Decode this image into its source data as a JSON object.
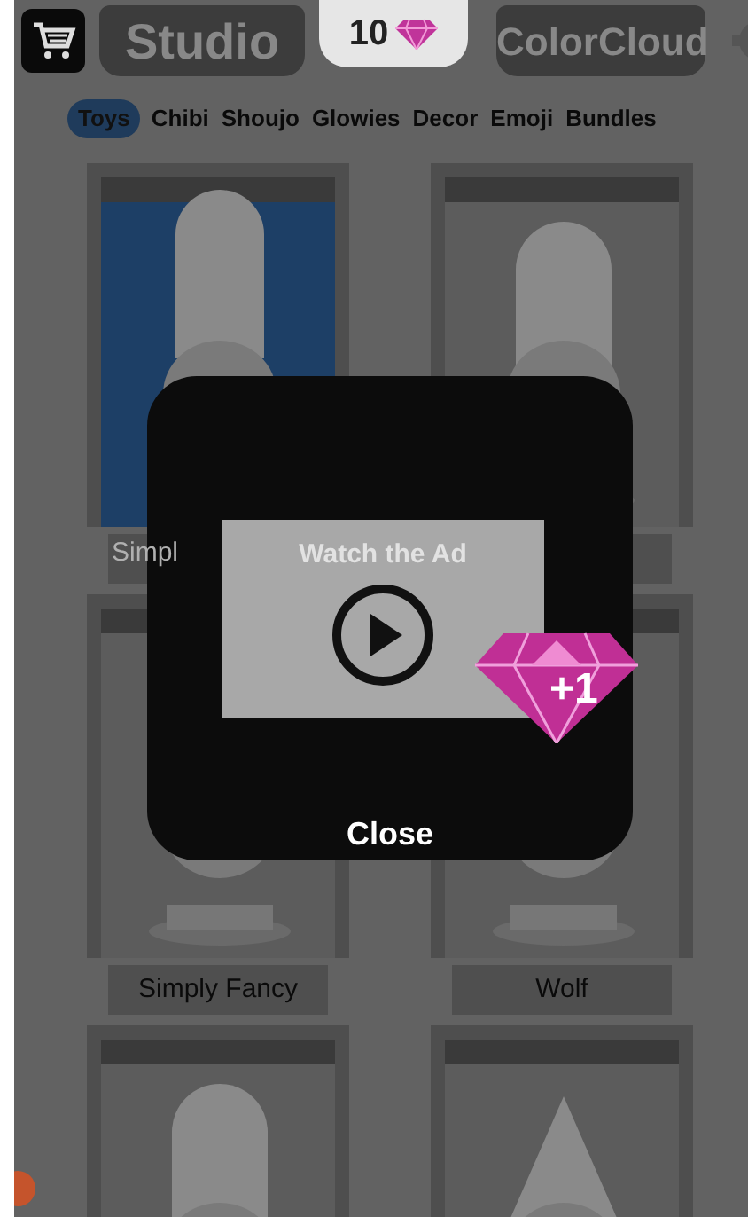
{
  "top_bar": {
    "studio": "Studio",
    "gem_count": "10",
    "colorcloud": "ColorCloud"
  },
  "categories": [
    {
      "label": "Toys",
      "selected": true
    },
    {
      "label": "Chibi",
      "selected": false
    },
    {
      "label": "Shoujo",
      "selected": false
    },
    {
      "label": "Glowies",
      "selected": false
    },
    {
      "label": "Decor",
      "selected": false
    },
    {
      "label": "Emoji",
      "selected": false
    },
    {
      "label": "Bundles",
      "selected": false
    }
  ],
  "shelves": [
    {
      "label": "Simpl",
      "selected": true
    },
    {
      "selected": false
    },
    {
      "label": "Simply Fancy",
      "selected": false
    },
    {
      "label": "Wolf",
      "selected": false
    },
    {
      "selected": false
    },
    {
      "selected": false
    }
  ],
  "dialog": {
    "ad_button": "Watch the Ad",
    "reward": "+1",
    "close": "Close"
  }
}
